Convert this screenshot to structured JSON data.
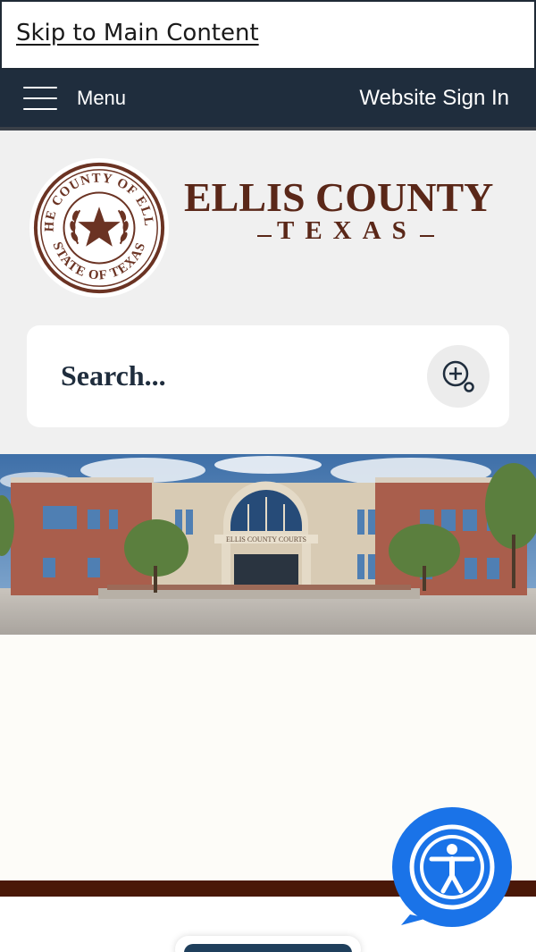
{
  "skip": {
    "label": "Skip to Main Content"
  },
  "nav": {
    "menu_label": "Menu",
    "signin_label": "Website Sign In"
  },
  "brand": {
    "title": "ELLIS COUNTY",
    "subtitle": "TEXAS",
    "seal_text_top": "THE COUNTY OF ELLIS",
    "seal_text_bottom": "STATE OF TEXAS"
  },
  "search": {
    "label": "Search..."
  },
  "hero": {
    "caption": "ELLIS COUNTY COURTS"
  },
  "colors": {
    "nav_bg": "#1f2d3d",
    "brand_brown": "#5a2718",
    "band_brown": "#4a1808",
    "a11y_blue": "#1a73e8"
  },
  "icons": {
    "search": "zoom-in-icon",
    "menu": "hamburger-icon",
    "accessibility": "accessibility-icon"
  }
}
